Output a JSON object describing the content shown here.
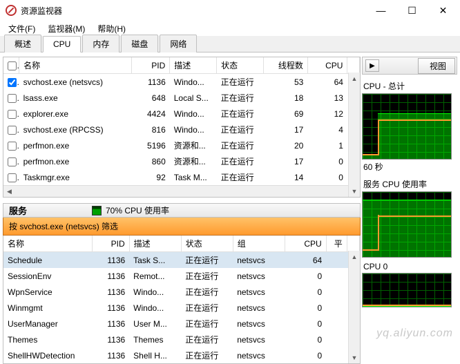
{
  "window": {
    "title": "资源监视器",
    "minimize": "—",
    "maximize": "☐",
    "close": "✕"
  },
  "menu": {
    "file": "文件(F)",
    "monitor": "监视器(M)",
    "help": "帮助(H)"
  },
  "tabs": {
    "overview": "概述",
    "cpu": "CPU",
    "memory": "内存",
    "disk": "磁盘",
    "network": "网络"
  },
  "proc_cols": {
    "chk": "",
    "name": "名称",
    "pid": "PID",
    "desc": "描述",
    "status": "状态",
    "threads": "线程数",
    "cpu": "CPU"
  },
  "processes": [
    {
      "chk": true,
      "name": "svchost.exe (netsvcs)",
      "pid": "1136",
      "desc": "Windo...",
      "status": "正在运行",
      "threads": "53",
      "cpu": "64"
    },
    {
      "chk": false,
      "name": "lsass.exe",
      "pid": "648",
      "desc": "Local S...",
      "status": "正在运行",
      "threads": "18",
      "cpu": "13"
    },
    {
      "chk": false,
      "name": "explorer.exe",
      "pid": "4424",
      "desc": "Windo...",
      "status": "正在运行",
      "threads": "69",
      "cpu": "12"
    },
    {
      "chk": false,
      "name": "svchost.exe (RPCSS)",
      "pid": "816",
      "desc": "Windo...",
      "status": "正在运行",
      "threads": "17",
      "cpu": "4"
    },
    {
      "chk": false,
      "name": "perfmon.exe",
      "pid": "5196",
      "desc": "资源和...",
      "status": "正在运行",
      "threads": "20",
      "cpu": "1"
    },
    {
      "chk": false,
      "name": "perfmon.exe",
      "pid": "860",
      "desc": "资源和...",
      "status": "正在运行",
      "threads": "17",
      "cpu": "0"
    },
    {
      "chk": false,
      "name": "Taskmgr.exe",
      "pid": "92",
      "desc": "Task M...",
      "status": "正在运行",
      "threads": "14",
      "cpu": "0"
    }
  ],
  "svc_header": {
    "label": "服务",
    "usage": "70% CPU 使用率"
  },
  "filter": {
    "text": "按 svchost.exe (netsvcs) 筛选"
  },
  "svc_cols": {
    "name": "名称",
    "pid": "PID",
    "desc": "描述",
    "status": "状态",
    "group": "组",
    "cpu": "CPU",
    "avg": "平"
  },
  "services": [
    {
      "name": "Schedule",
      "pid": "1136",
      "desc": "Task S...",
      "status": "正在运行",
      "group": "netsvcs",
      "cpu": "64",
      "sel": true
    },
    {
      "name": "SessionEnv",
      "pid": "1136",
      "desc": "Remot...",
      "status": "正在运行",
      "group": "netsvcs",
      "cpu": "0"
    },
    {
      "name": "WpnService",
      "pid": "1136",
      "desc": "Windo...",
      "status": "正在运行",
      "group": "netsvcs",
      "cpu": "0"
    },
    {
      "name": "Winmgmt",
      "pid": "1136",
      "desc": "Windo...",
      "status": "正在运行",
      "group": "netsvcs",
      "cpu": "0"
    },
    {
      "name": "UserManager",
      "pid": "1136",
      "desc": "User M...",
      "status": "正在运行",
      "group": "netsvcs",
      "cpu": "0"
    },
    {
      "name": "Themes",
      "pid": "1136",
      "desc": "Themes",
      "status": "正在运行",
      "group": "netsvcs",
      "cpu": "0"
    },
    {
      "name": "ShellHWDetection",
      "pid": "1136",
      "desc": "Shell H...",
      "status": "正在运行",
      "group": "netsvcs",
      "cpu": "0"
    }
  ],
  "right": {
    "view_btn": "视图",
    "expand_glyph": "▶",
    "charts": [
      {
        "title": "CPU - 总计",
        "sub": "60 秒"
      },
      {
        "title": "服务 CPU 使用率"
      },
      {
        "title": "CPU 0"
      }
    ]
  },
  "watermark": "yq.aliyun.com"
}
